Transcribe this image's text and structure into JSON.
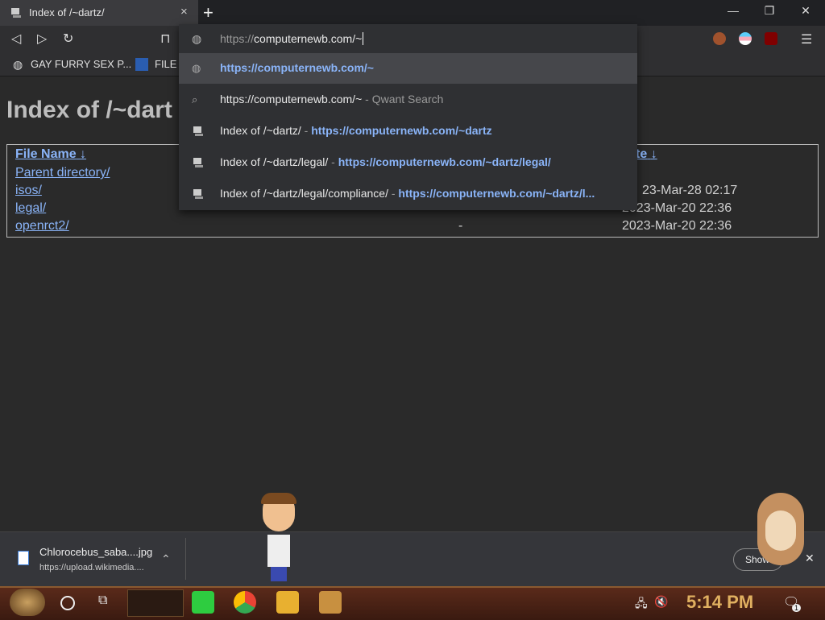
{
  "tab": {
    "title": "Index of /~dartz/",
    "close_icon": "×",
    "new_tab": "+"
  },
  "window": {
    "minimize": "—",
    "restore": "❐",
    "close": "✕"
  },
  "toolbar": {
    "back": "◁",
    "forward": "▷",
    "reload": "↻",
    "bookmark": "⊓"
  },
  "omnibox": {
    "input_scheme": "https://",
    "input_host": "computernewb.com/~",
    "suggestions": [
      {
        "text": "",
        "url": "https://computernewb.com/~",
        "suffix": ""
      },
      {
        "text": "https://computernewb.com/~",
        "url": "",
        "suffix": " - Qwant Search"
      },
      {
        "text": "Index of /~dartz/",
        "url": "https://computernewb.com/~dartz",
        "suffix": ""
      },
      {
        "text": "Index of /~dartz/legal/",
        "url": "https://computernewb.com/~dartz/legal/",
        "suffix": ""
      },
      {
        "text": "Index of /~dartz/legal/compliance/",
        "url": "https://computernewb.com/~dartz/l...",
        "suffix": ""
      }
    ]
  },
  "bookmarks": [
    {
      "label": "GAY FURRY SEX P..."
    },
    {
      "label": "FILE"
    }
  ],
  "page": {
    "title": "Index of /~dart",
    "headers": {
      "name": "File Name",
      "sort_arrow": "↓",
      "date": "te",
      "date_arrow": "↓"
    },
    "rows": [
      {
        "name": "Parent directory/",
        "size": "",
        "date": ""
      },
      {
        "name": "isos/",
        "size": "",
        "date": "23-Mar-28 02:17"
      },
      {
        "name": "legal/",
        "size": "",
        "date": "2023-Mar-20 22:36"
      },
      {
        "name": "openrct2/",
        "size": "-",
        "date": "2023-Mar-20 22:36"
      }
    ]
  },
  "download": {
    "filename": "Chlorocebus_saba....jpg",
    "source": "https://upload.wikimedia....",
    "show_all": "Show"
  },
  "taskbar": {
    "time": "5:14 PM",
    "notification_count": "1"
  }
}
